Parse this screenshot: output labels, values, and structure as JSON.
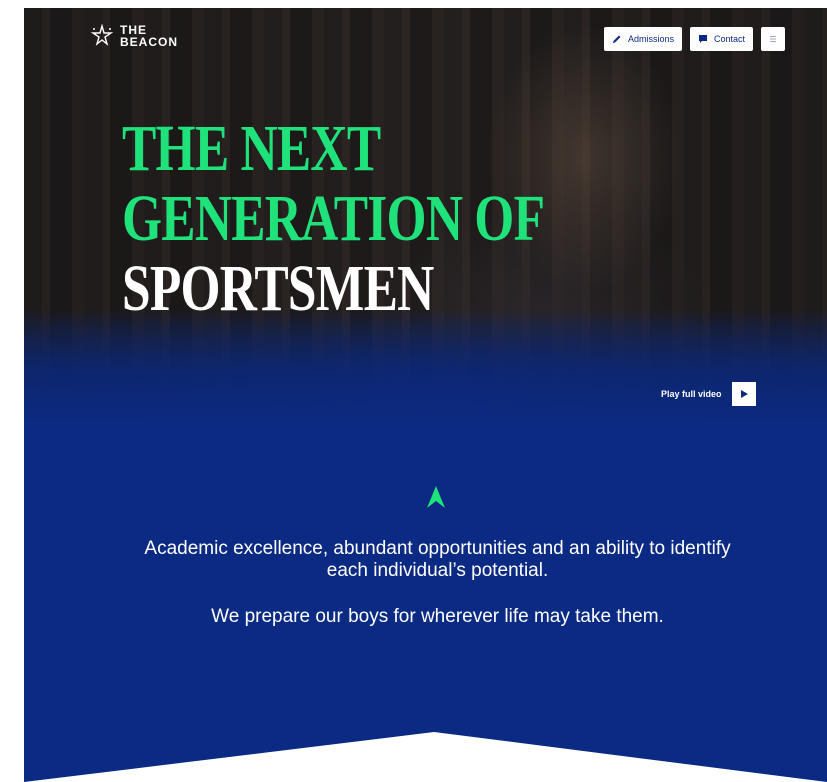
{
  "header": {
    "logo_line1": "THE",
    "logo_line2": "BEACON",
    "admissions_label": "Admissions",
    "contact_label": "Contact"
  },
  "hero": {
    "headline_line1": "THE NEXT",
    "headline_line2": "GENERATION OF",
    "headline_line3": "SPORTSMEN",
    "play_label": "Play full video"
  },
  "intro": {
    "paragraph1": "Academic excellence, abundant opportunities and an ability to identify each individual’s potential.",
    "paragraph2": "We prepare our boys for wherever life may take them."
  },
  "colors": {
    "brand_blue": "#0b2a83",
    "accent_green": "#1fe27a",
    "white": "#ffffff"
  },
  "icons": {
    "logo": "beacon-star-icon",
    "admissions": "pencil-icon",
    "contact": "speech-bubble-icon",
    "menu": "hamburger-menu-icon",
    "play": "play-icon",
    "scroll": "chevron-up-arrow-icon"
  }
}
